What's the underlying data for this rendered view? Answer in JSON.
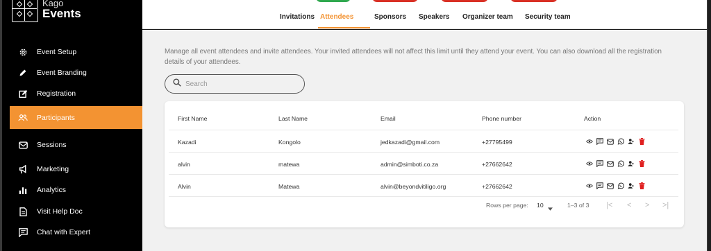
{
  "brand": {
    "line1": "Kago",
    "line2": "Events"
  },
  "sidebar": {
    "items": [
      {
        "label": "Event Setup",
        "icon": "gear-icon"
      },
      {
        "label": "Event Branding",
        "icon": "pencil-icon"
      },
      {
        "label": "Registration",
        "icon": "edit-icon"
      },
      {
        "label": "Participants",
        "icon": "people-icon",
        "active": true
      },
      {
        "label": "Sessions",
        "icon": "mail-icon"
      },
      {
        "label": "Marketing",
        "icon": "megaphone-icon"
      },
      {
        "label": "Analytics",
        "icon": "bar-chart-icon"
      },
      {
        "label": "Visit Help Doc",
        "icon": "document-icon"
      },
      {
        "label": "Chat with Expert",
        "icon": "chat-icon"
      }
    ],
    "active_color": "#f39332"
  },
  "tabs": [
    {
      "label": "Invitations"
    },
    {
      "label": "Attendees",
      "active": true
    },
    {
      "label": "Sponsors"
    },
    {
      "label": "Speakers"
    },
    {
      "label": "Organizer team"
    },
    {
      "label": "Security team"
    }
  ],
  "description": "Manage all event attendees and invite attendees. Your invited attendees will not affect this limit until they attend your event. You can also download all the registration details of your attendees.",
  "search": {
    "placeholder": "Search",
    "value": ""
  },
  "table": {
    "columns": [
      "First Name",
      "Last Name",
      "Email",
      "Phone number",
      "Action"
    ],
    "rows": [
      {
        "first": "Kazadi",
        "last": "Kongolo",
        "email": "jedkazadi@gmail.com",
        "phone": "+27795499"
      },
      {
        "first": "alvin",
        "last": "matewa",
        "email": "admin@simboti.co.za",
        "phone": "+27662642"
      },
      {
        "first": "Alvin",
        "last": "Matewa",
        "email": "alvin@beyondvitiligo.org",
        "phone": "+27662642"
      }
    ],
    "action_icons": [
      "eye-icon",
      "message-icon",
      "mail-icon",
      "whatsapp-icon",
      "person-icon",
      "trash-icon"
    ]
  },
  "pagination": {
    "rows_per_page_label": "Rows per page:",
    "rows_per_page_value": "10",
    "range": "1–3 of 3"
  },
  "colors": {
    "accent": "#f39332",
    "delete": "#e02020",
    "pill_green": "#2fa84f",
    "pill_red": "#d93025"
  }
}
